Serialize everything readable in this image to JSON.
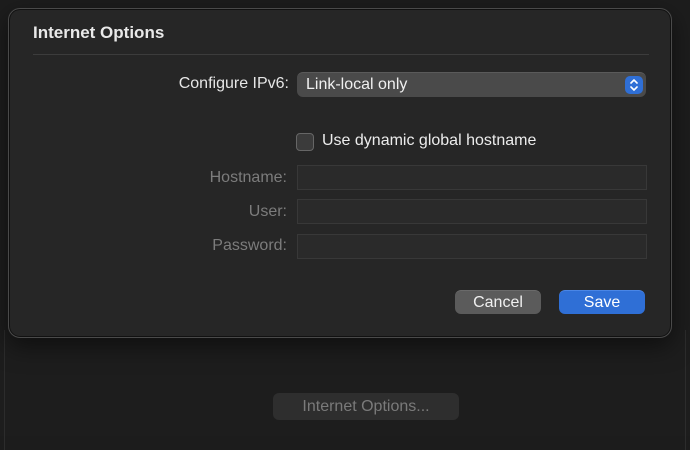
{
  "dialog": {
    "title": "Internet Options",
    "configure_ipv6_label": "Configure IPv6:",
    "configure_ipv6_value": "Link-local only",
    "dynamic_hostname_label": "Use dynamic global hostname",
    "dynamic_hostname_checked": false,
    "hostname_label": "Hostname:",
    "user_label": "User:",
    "password_label": "Password:",
    "hostname_value": "",
    "user_value": "",
    "password_value": "",
    "cancel_label": "Cancel",
    "save_label": "Save"
  },
  "background": {
    "internet_options_button_label": "Internet Options..."
  },
  "colors": {
    "accent": "#2f6fd6",
    "dialog_bg": "#262626",
    "disabled_text": "#7c7c7c"
  },
  "icons": {
    "popup_arrows": "chevron-up-down-icon"
  }
}
